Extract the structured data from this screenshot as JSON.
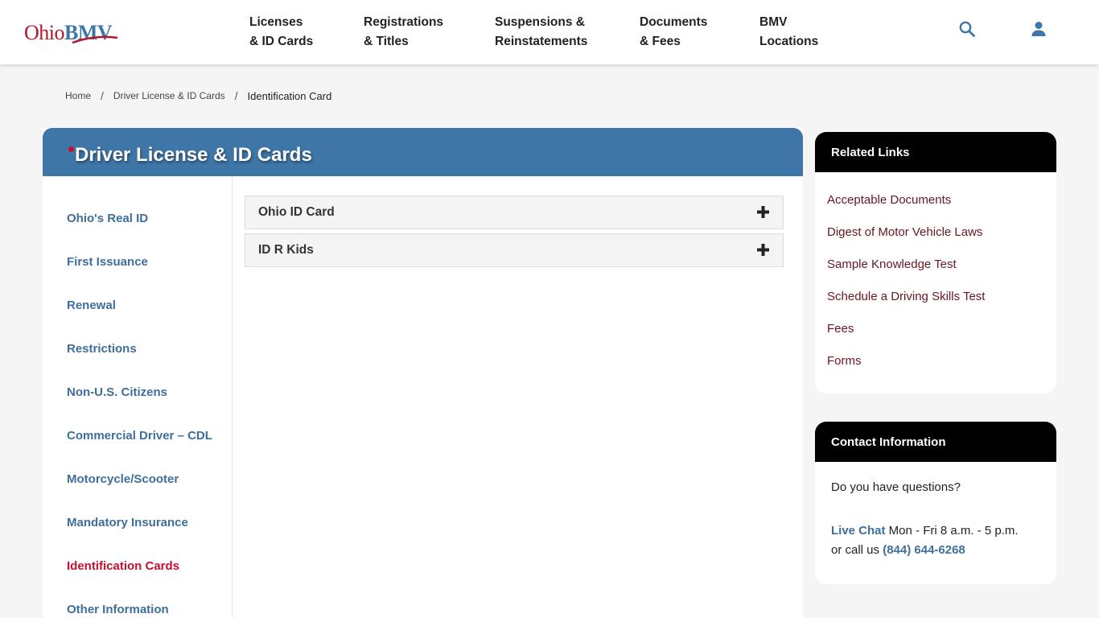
{
  "header": {
    "logo_ohio": "Ohio",
    "logo_bmv": "BMV",
    "nav": [
      {
        "line1": "Licenses",
        "line2": "& ID Cards"
      },
      {
        "line1": "Registrations",
        "line2": "& Titles"
      },
      {
        "line1": "Suspensions &",
        "line2": "Reinstatements"
      },
      {
        "line1": "Documents",
        "line2": "& Fees"
      },
      {
        "line1": "BMV",
        "line2": "Locations"
      }
    ],
    "icons": {
      "search": "search-icon",
      "account": "user-icon"
    }
  },
  "breadcrumb": {
    "items": [
      "Home",
      "Driver License & ID Cards"
    ],
    "current": "Identification Card",
    "separator": "/"
  },
  "main": {
    "title": "Driver License & ID Cards",
    "sidenav": [
      "Ohio's Real ID",
      "First Issuance",
      "Renewal",
      "Restrictions",
      "Non-U.S. Citizens",
      "Commercial Driver – CDL",
      "Motorcycle/Scooter",
      "Mandatory Insurance",
      "Identification Cards",
      "Other Information"
    ],
    "active_sidenav": "Identification Cards",
    "accordions": [
      {
        "label": "Ohio ID Card",
        "icon": "plus-icon"
      },
      {
        "label": "ID R Kids",
        "icon": "plus-icon"
      }
    ]
  },
  "related_links": {
    "title": "Related Links",
    "links": [
      "Acceptable Documents",
      "Digest of Motor Vehicle Laws",
      "Sample Knowledge Test",
      "Schedule a Driving Skills Test",
      "Fees",
      "Forms"
    ]
  },
  "contact": {
    "title": "Contact Information",
    "question": "Do you have questions?",
    "live_chat_label": "Live Chat",
    "live_chat_hours": " Mon - Fri 8 a.m. - 5 p.m.",
    "call_prefix": "or call us ",
    "phone": "(844) 644-6268"
  },
  "colors": {
    "brand_blue": "#3e76a8",
    "brand_red": "#c8102e",
    "link_maroon": "#6b1523",
    "card_header": "#000000"
  }
}
